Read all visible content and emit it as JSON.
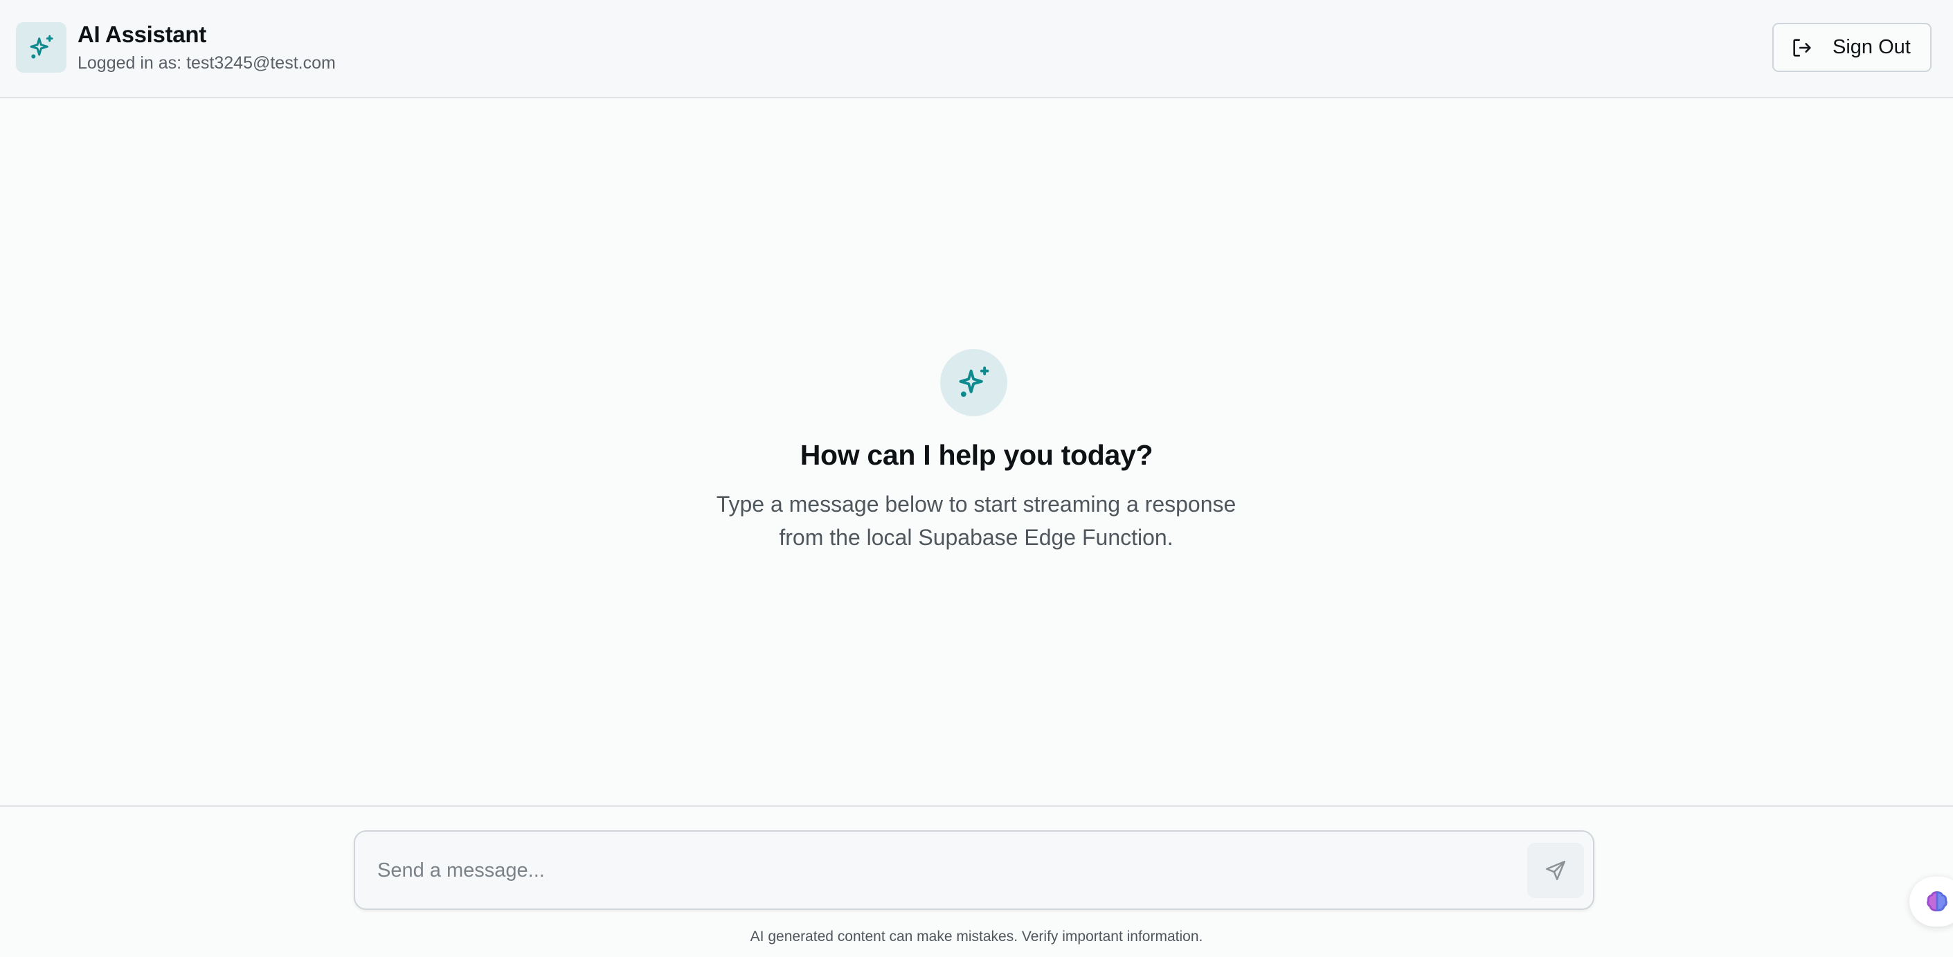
{
  "header": {
    "title": "AI Assistant",
    "user_line": "Logged in as: test3245@test.com",
    "signout_label": "Sign Out",
    "logo_icon": "sparkles-icon"
  },
  "empty_state": {
    "icon": "sparkles-icon",
    "title": "How can I help you today?",
    "subtitle": "Type a message below to start streaming a response from the local Supabase Edge Function."
  },
  "composer": {
    "placeholder": "Send a message...",
    "value": "",
    "send_icon": "send-icon"
  },
  "footer": {
    "disclaimer": "AI generated content can make mistakes. Verify important information."
  },
  "colors": {
    "accent": "#0e8a8f",
    "icon_bg": "#dcecee",
    "page_bg": "#fafbfb"
  }
}
